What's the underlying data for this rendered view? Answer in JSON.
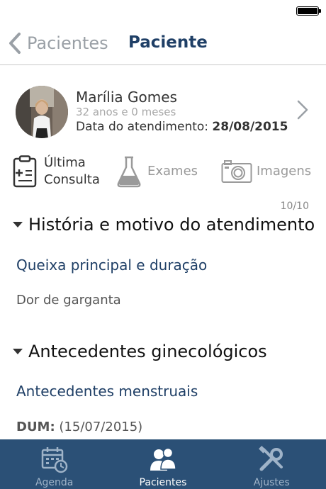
{
  "nav": {
    "back_label": "Pacientes",
    "title": "Paciente"
  },
  "patient": {
    "name": "Marília Gomes",
    "age": "32 anos e 0 meses",
    "date_label": "Data do atendimento:",
    "date_value": "28/08/2015"
  },
  "actions": {
    "last_visit_line1": "Última",
    "last_visit_line2": "Consulta",
    "exams": "Exames",
    "images": "Imagens"
  },
  "counter": "10/10",
  "sections": [
    {
      "title": "História e motivo do atendimento",
      "subtitle": "Queixa principal e duração",
      "text": "Dor de garganta"
    },
    {
      "title": "Antecedentes ginecológicos",
      "subtitle": "Antecedentes menstruais",
      "text_label": "DUM:",
      "text_value": "(15/07/2015)"
    }
  ],
  "tabs": [
    {
      "label": "Agenda",
      "icon": "calendar-clock-icon"
    },
    {
      "label": "Pacientes",
      "icon": "people-icon",
      "active": true
    },
    {
      "label": "Ajustes",
      "icon": "tools-icon"
    }
  ],
  "colors": {
    "primary": "#1f3f66",
    "tab_bar": "#2b5076",
    "muted": "#9aa0a6"
  }
}
